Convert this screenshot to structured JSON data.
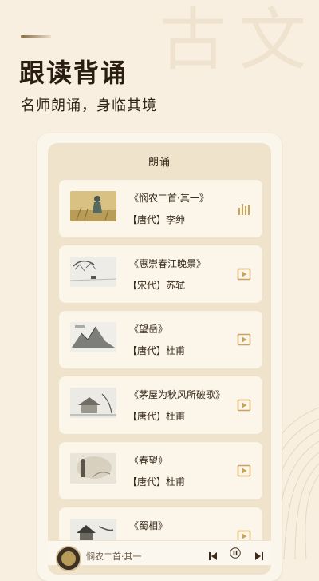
{
  "background_glyphs": [
    "古",
    "文"
  ],
  "hero": {
    "title": "跟读背诵",
    "subtitle": "名师朗诵，身临其境"
  },
  "panel": {
    "title": "朗诵",
    "items": [
      {
        "title": "《悯农二首·其一》",
        "author": "【唐代】李绅",
        "state": "playing",
        "icon": "equalizer-icon"
      },
      {
        "title": "《惠崇春江晚景》",
        "author": "【宋代】苏轼",
        "state": "idle",
        "icon": "play-icon"
      },
      {
        "title": "《望岳》",
        "author": "【唐代】杜甫",
        "state": "idle",
        "icon": "play-icon"
      },
      {
        "title": "《茅屋为秋风所破歌》",
        "author": "【唐代】杜甫",
        "state": "idle",
        "icon": "play-icon"
      },
      {
        "title": "《春望》",
        "author": "【唐代】杜甫",
        "state": "idle",
        "icon": "play-icon"
      },
      {
        "title": "《蜀相》",
        "author": "",
        "state": "idle",
        "icon": "play-icon"
      }
    ]
  },
  "player": {
    "now_playing": "悯农二首·其一"
  },
  "colors": {
    "background": "#f8efe1",
    "panel": "#efe3cb",
    "item": "#fbf5ea",
    "accent": "#c9a25c"
  }
}
